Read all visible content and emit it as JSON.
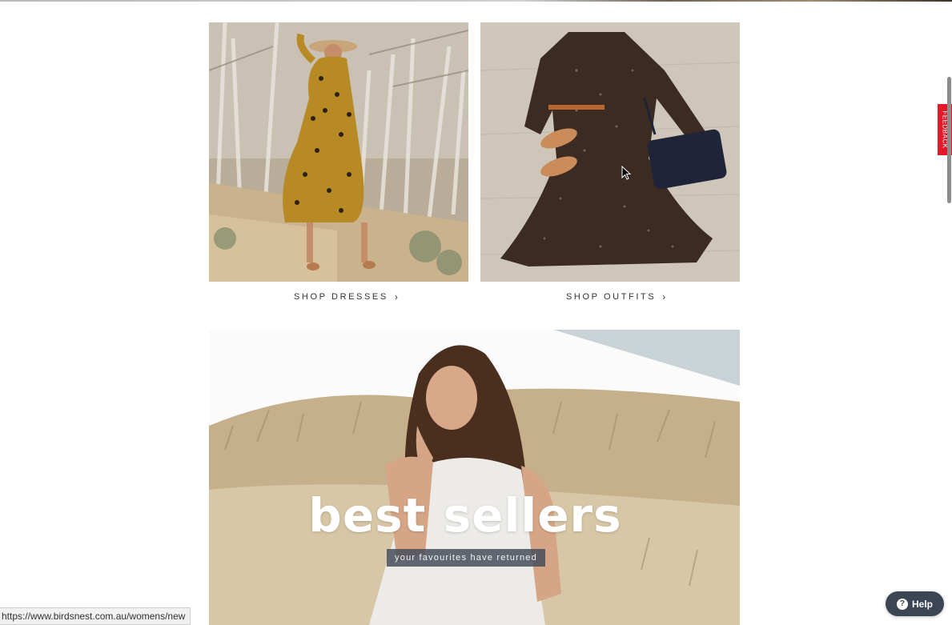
{
  "tiles": [
    {
      "name": "dresses",
      "link_label": "SHOP DRESSES",
      "chevron": "›"
    },
    {
      "name": "outfits",
      "link_label": "SHOP OUTFITS",
      "chevron": "›"
    }
  ],
  "hero": {
    "title": "best sellers",
    "subtitle": "your favourites have returned"
  },
  "feedback": {
    "label": "FEEDBACK",
    "color": "#e3192a"
  },
  "help": {
    "label": "Help",
    "icon": "question-icon"
  },
  "status_bar": {
    "url": "https://www.birdsnest.com.au/womens/new"
  },
  "colors": {
    "help_bg": "#3c4553",
    "hero_sub_bg": "#464e5c"
  }
}
